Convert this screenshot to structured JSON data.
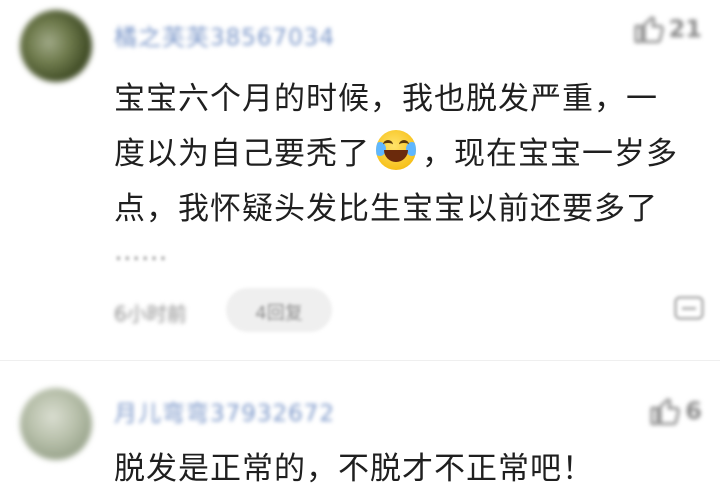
{
  "comments": [
    {
      "username": "橘之芙芙38567034",
      "likes": "21",
      "text_line1": "宝宝六个月的时候，我也脱发严重，一",
      "text_line2a": "度以为自己要秃了",
      "text_line2b": "，现在宝宝一岁多",
      "text_line3": "点，我怀疑头发比生宝宝以前还要多了",
      "ellipsis": "......",
      "time_ago": "6小时前",
      "reply_label": "4回复",
      "emoji": "laughing-crying-emoji"
    },
    {
      "username": "月儿弯弯37932672",
      "likes": "6",
      "text": "脱发是正常的，不脱才不正常吧！"
    }
  ],
  "icons": {
    "like": "thumbs-up-icon",
    "more": "more-options-icon"
  },
  "colors": {
    "username": "#7b97c9",
    "text": "#1f1f1f",
    "muted": "#8d8d8d"
  }
}
